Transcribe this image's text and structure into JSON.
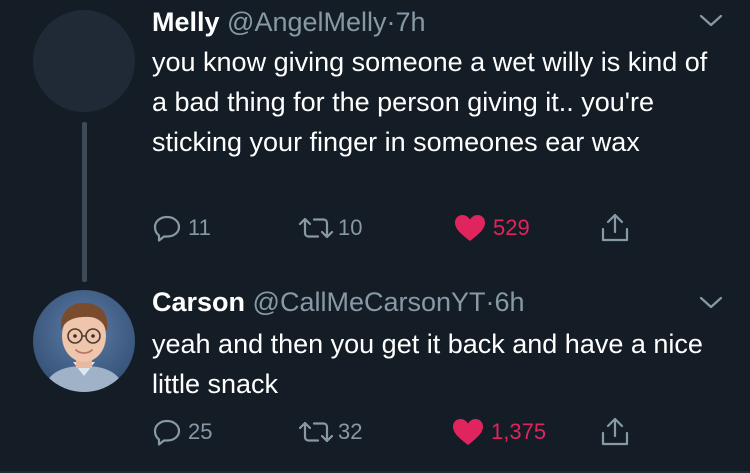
{
  "colors": {
    "background": "#141d26",
    "text": "#ffffff",
    "muted": "#8899a6",
    "like": "#e0245e"
  },
  "tweets": [
    {
      "name": "Melly",
      "handle": "@AngelMelly",
      "separator": "·",
      "time": "7h",
      "text": "you know giving someone a wet willy is kind of a bad thing for the person giving it.. you're sticking your finger in someones ear wax",
      "replies": "11",
      "retweets": "10",
      "likes": "529",
      "liked": true,
      "avatar": "blank-avatar"
    },
    {
      "name": "Carson",
      "handle": "@CallMeCarsonYT",
      "separator": "·",
      "time": "6h",
      "text": "yeah and then you get it back and have a nice little snack",
      "replies": "25",
      "retweets": "32",
      "likes": "1,375",
      "liked": true,
      "avatar": "photo-avatar"
    }
  ]
}
